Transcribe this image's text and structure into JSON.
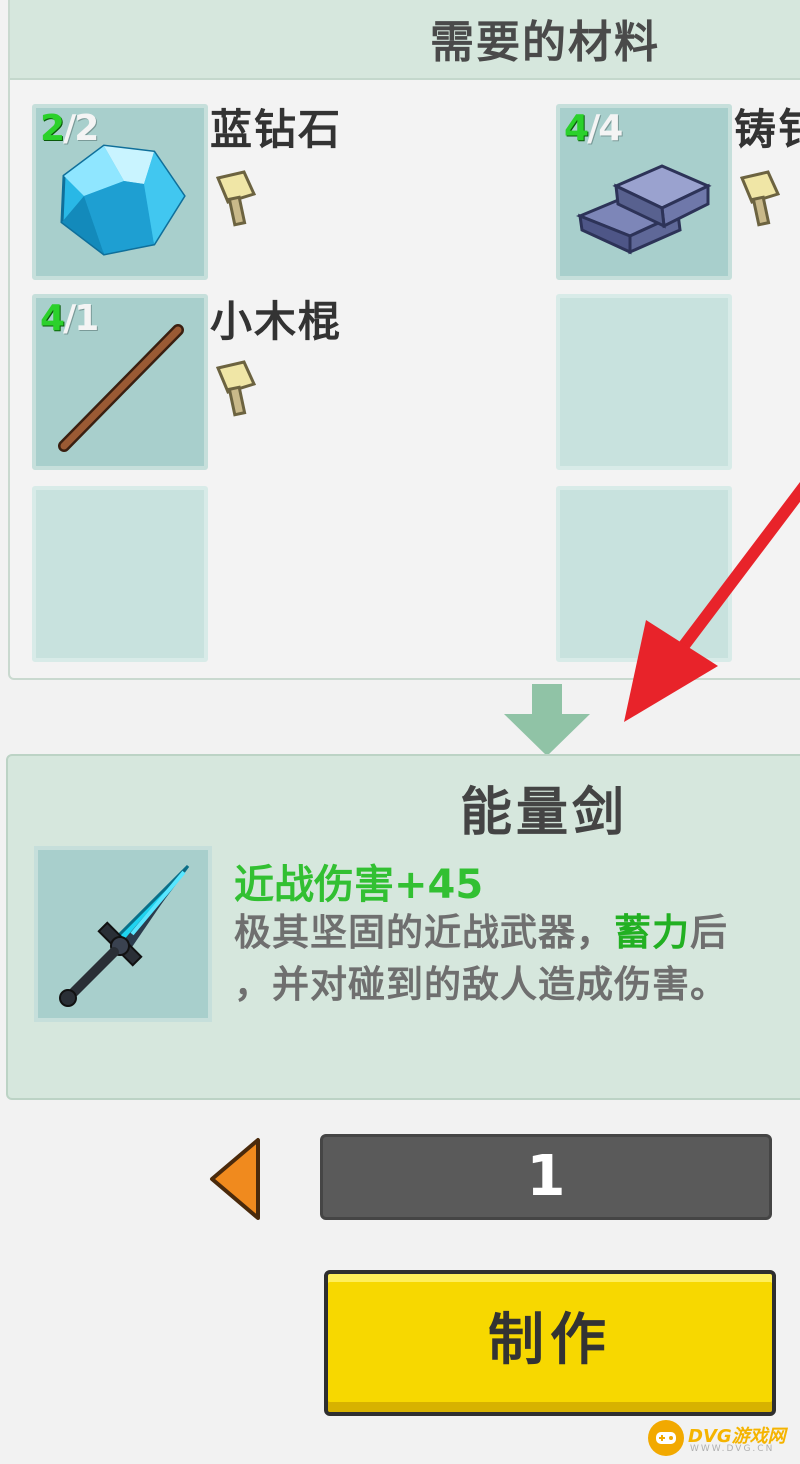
{
  "materials": {
    "title": "需要的材料",
    "items": [
      {
        "name": "蓝钻石",
        "have": "2",
        "need": "/2",
        "icon": "blue-diamond-icon"
      },
      {
        "name": "铸钅",
        "have": "4",
        "need": "/4",
        "icon": "iron-ingot-icon"
      },
      {
        "name": "小木棍",
        "have": "4",
        "need": "/1",
        "icon": "wooden-stick-icon"
      }
    ]
  },
  "result": {
    "name": "能量剑",
    "stat": "近战伤害+45",
    "desc_line1_a": "极其坚固的近战武器，",
    "desc_line1_highlight": "蓄力",
    "desc_line1_b": "后",
    "desc_line2": "，并对碰到的敌人造成伤害。",
    "icon": "energy-sword-icon"
  },
  "quantity": {
    "value": "1"
  },
  "craft_button": {
    "label": "制作"
  },
  "watermark": {
    "text": "DVG游戏网",
    "sub": "WWW.DVG.CN"
  },
  "colors": {
    "panel_header": "#d6e7dd",
    "slot": "#a8cfcc",
    "have_count": "#2bd12b",
    "stat": "#32c032",
    "craft_button": "#f7d800",
    "red_annotation": "#e8232a"
  }
}
